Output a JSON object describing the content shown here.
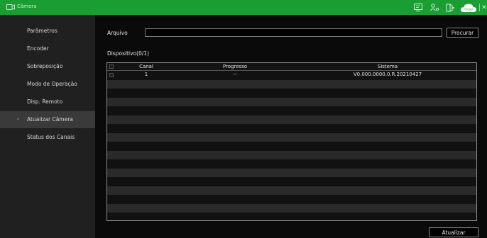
{
  "titlebar": {
    "title": "Câmera",
    "icons": [
      "camera-icon",
      "monitor-icon",
      "user-icon",
      "exit-icon",
      "cloud-icon",
      "close-icon"
    ],
    "cloud_text": "Cloud",
    "close_glyph": "✕"
  },
  "sidebar": {
    "items": [
      {
        "label": "Parâmetros"
      },
      {
        "label": "Encoder"
      },
      {
        "label": "Sobreposição"
      },
      {
        "label": "Modo de Operação"
      },
      {
        "label": "Disp. Remoto"
      },
      {
        "label": "Atualizar Câmera",
        "active": true
      },
      {
        "label": "Status dos Canais"
      }
    ],
    "active_marker": "›"
  },
  "main": {
    "arquivo_label": "Arquivo",
    "arquivo_value": "",
    "procurar_label": "Procurar",
    "dispositivo_label": "Dispositivo(0/1)",
    "table": {
      "headers": [
        "Canal",
        "Progresso",
        "Sistema"
      ],
      "rows": [
        {
          "canal": "1",
          "progresso": "--",
          "sistema": "V0.000.0000.0.R.20210427"
        }
      ]
    },
    "atualizar_label": "Atualizar"
  },
  "colors": {
    "titlebar": "#1a9e33",
    "sidebar": "#202020",
    "row_alt": "#2a2a2a"
  }
}
